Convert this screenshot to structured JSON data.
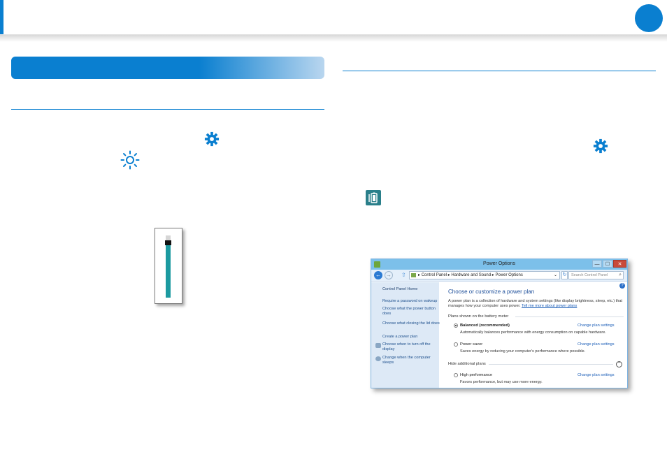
{
  "colors": {
    "accent": "#0a7fd0",
    "slider_fill": "#1c9aa0",
    "battery_icon": "#2a7f8a"
  },
  "icons": {
    "settings": "gear-icon",
    "brightness": "sun-icon",
    "battery": "battery-icon"
  },
  "brightness_slider": {
    "level": 0.85
  },
  "power_options": {
    "title": "Power Options",
    "controls": {
      "minimize": "—",
      "maximize": "☐",
      "close": "✕"
    },
    "address": {
      "crumbs": [
        "Control Panel",
        "Hardware and Sound",
        "Power Options"
      ],
      "separator": "▸"
    },
    "search_placeholder": "Search Control Panel",
    "sidebar": {
      "home": "Control Panel Home",
      "links": [
        "Require a password on wakeup",
        "Choose what the power button does",
        "Choose what closing the lid does",
        "Create a power plan",
        "Choose when to turn off the display",
        "Change when the computer sleeps"
      ]
    },
    "main": {
      "heading": "Choose or customize a power plan",
      "description": "A power plan is a collection of hardware and system settings (like display brightness, sleep, etc.) that manages how your computer uses power.",
      "description_link": "Tell me more about power plans",
      "group_battery": "Plans shown on the battery meter",
      "plans": [
        {
          "name": "Balanced (recommended)",
          "desc": "Automatically balances performance with energy consumption on capable hardware.",
          "link": "Change plan settings",
          "selected": true
        },
        {
          "name": "Power saver",
          "desc": "Saves energy by reducing your computer's performance where possible.",
          "link": "Change plan settings",
          "selected": false
        }
      ],
      "group_hidden": "Hide additional plans",
      "hidden_plans": [
        {
          "name": "High performance",
          "desc": "Favors performance, but may use more energy.",
          "link": "Change plan settings",
          "selected": false
        }
      ]
    }
  }
}
